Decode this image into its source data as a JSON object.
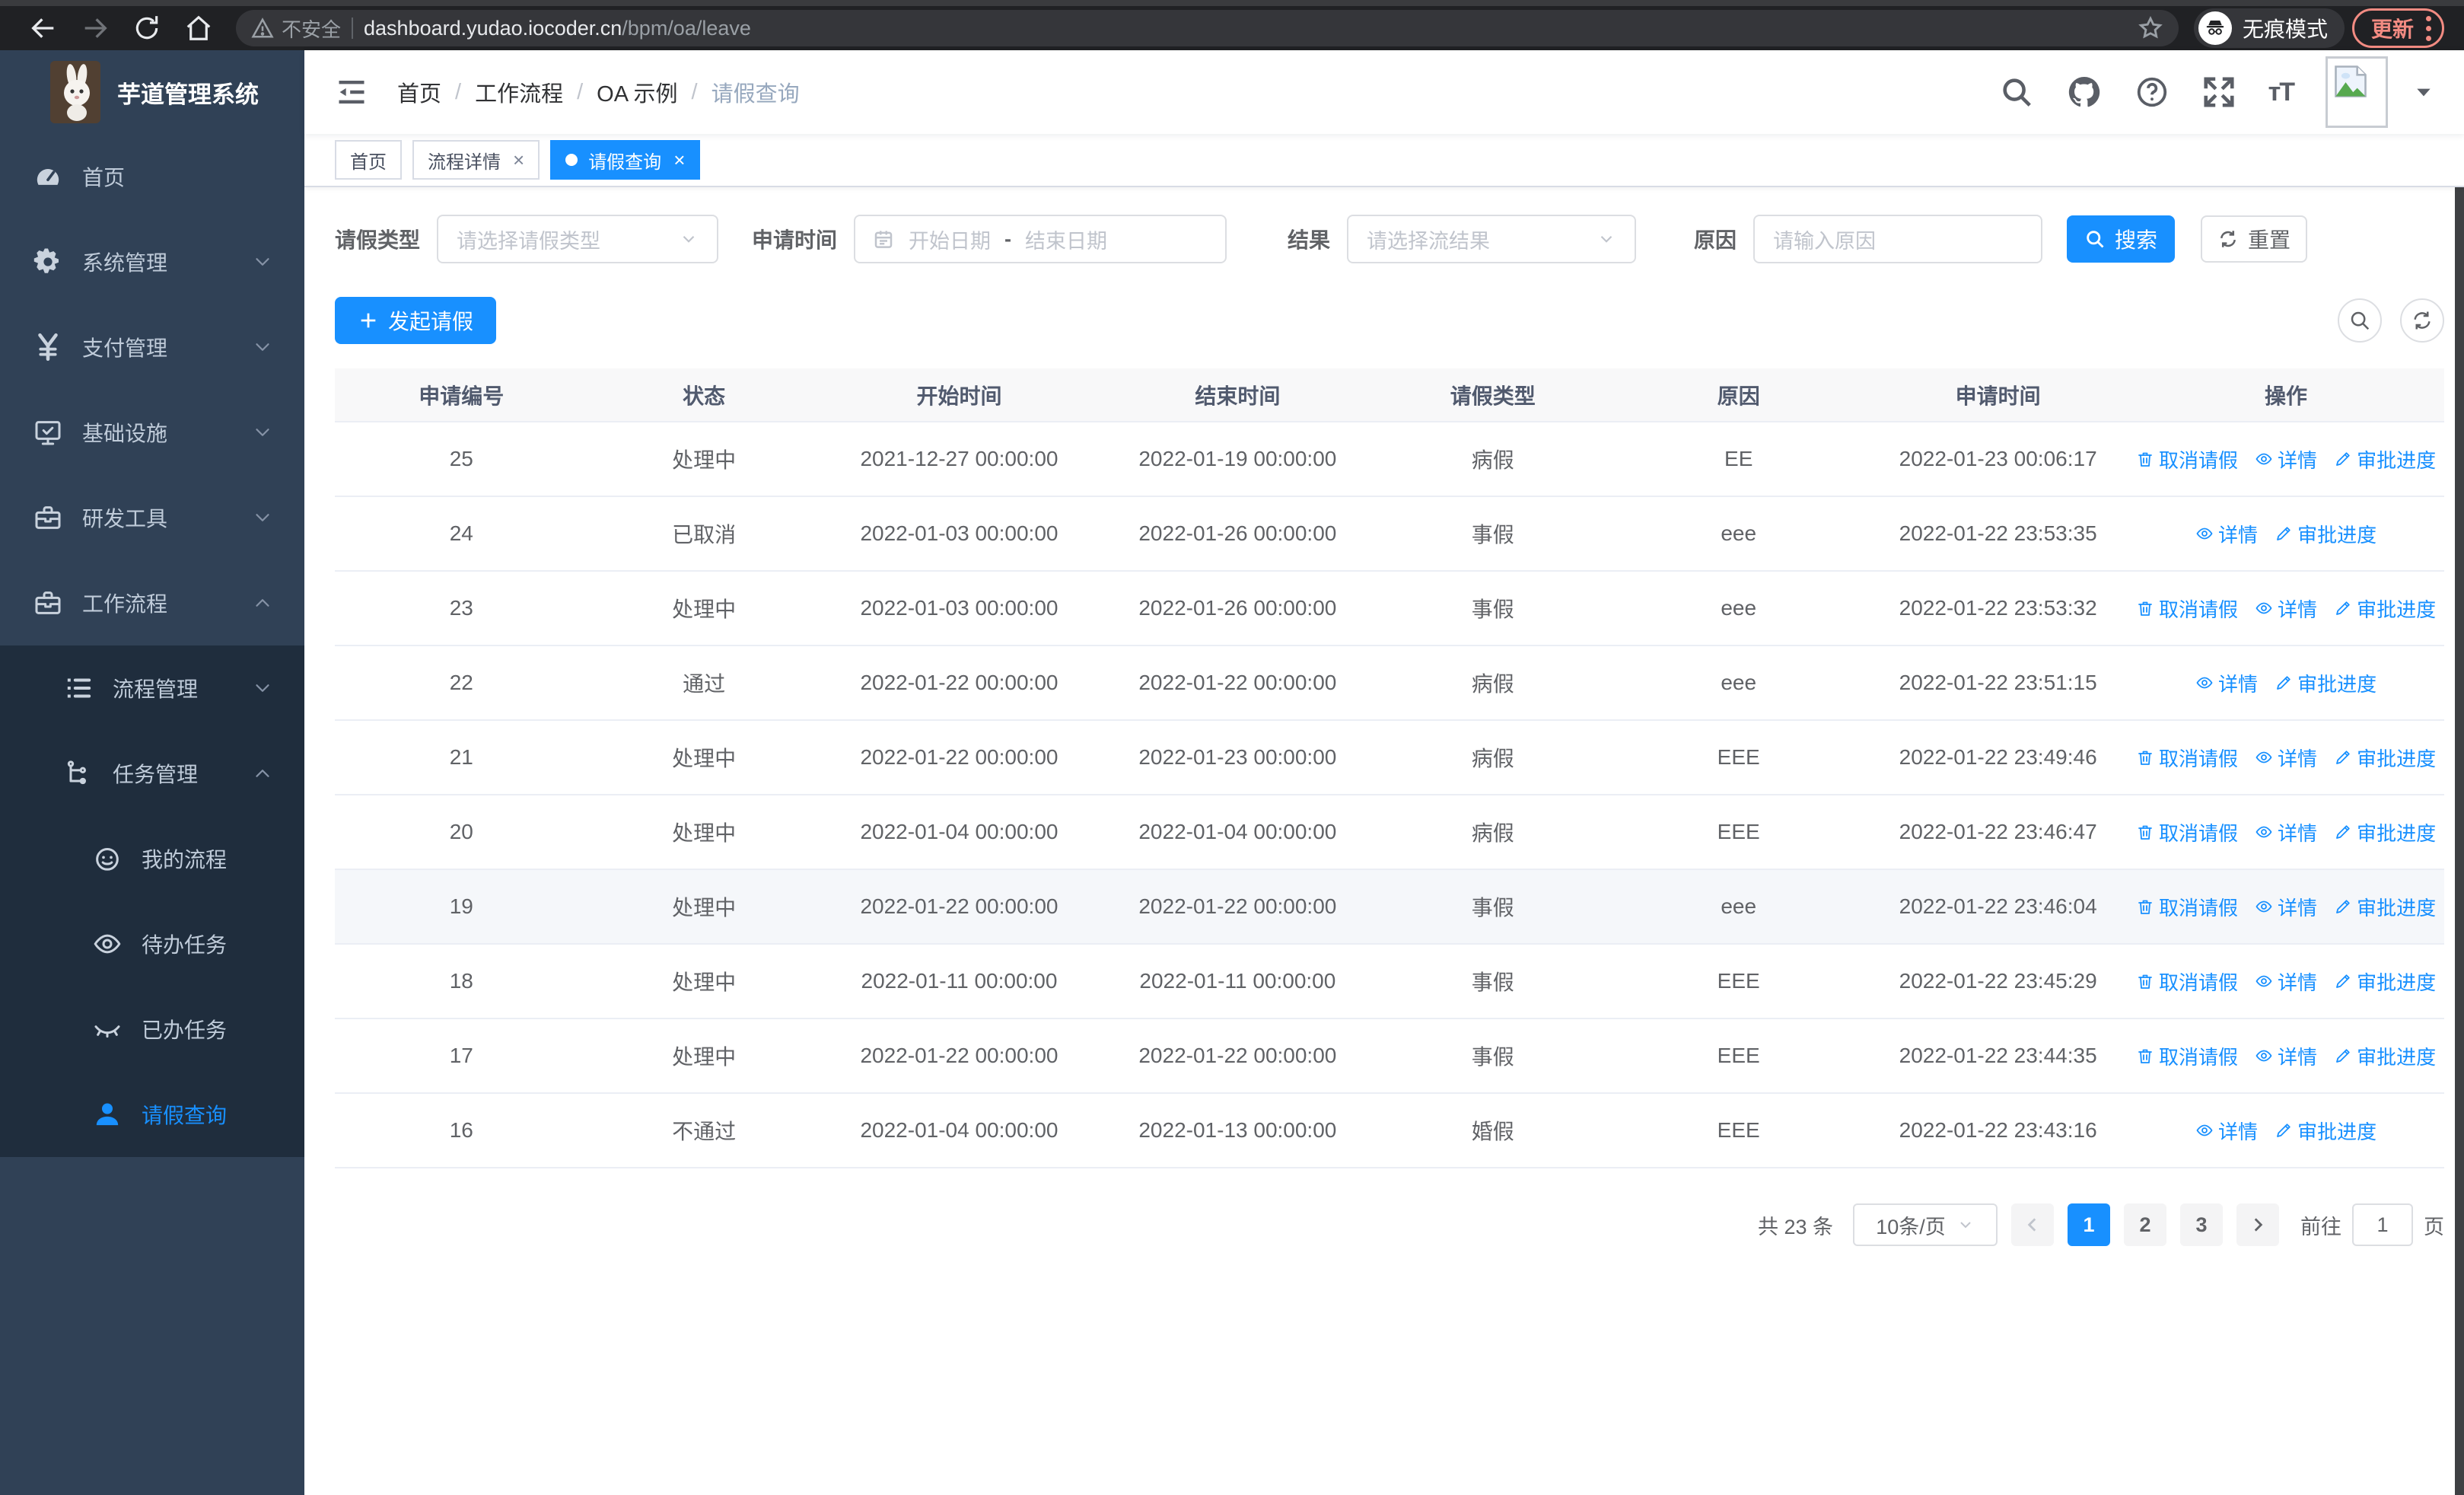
{
  "browser": {
    "security_label": "不安全",
    "url_host": "dashboard.yudao.iocoder.cn",
    "url_path": "/bpm/oa/leave",
    "incognito_label": "无痕模式",
    "update_label": "更新"
  },
  "app": {
    "title": "芋道管理系统"
  },
  "breadcrumb": {
    "items": [
      {
        "label": "首页",
        "current": false
      },
      {
        "label": "工作流程",
        "current": false
      },
      {
        "label": "OA 示例",
        "current": false
      },
      {
        "label": "请假查询",
        "current": true
      }
    ]
  },
  "tabs": [
    {
      "label": "首页",
      "active": false,
      "closable": false
    },
    {
      "label": "流程详情",
      "active": false,
      "closable": true
    },
    {
      "label": "请假查询",
      "active": true,
      "closable": true
    }
  ],
  "sidebar": {
    "items": [
      {
        "label": "首页",
        "icon": "dashboard-icon",
        "level": 1,
        "chevron": "",
        "in_section": false,
        "active": false
      },
      {
        "label": "系统管理",
        "icon": "gear-icon",
        "level": 1,
        "chevron": "down",
        "in_section": false,
        "active": false
      },
      {
        "label": "支付管理",
        "icon": "yen-icon",
        "level": 1,
        "chevron": "down",
        "in_section": false,
        "active": false
      },
      {
        "label": "基础设施",
        "icon": "monitor-icon",
        "level": 1,
        "chevron": "down",
        "in_section": false,
        "active": false
      },
      {
        "label": "研发工具",
        "icon": "toolbox-icon",
        "level": 1,
        "chevron": "down",
        "in_section": false,
        "active": false
      },
      {
        "label": "工作流程",
        "icon": "briefcase-icon",
        "level": 1,
        "chevron": "up",
        "in_section": false,
        "active": false
      },
      {
        "label": "流程管理",
        "icon": "process-icon",
        "level": 2,
        "chevron": "down",
        "in_section": true,
        "active": false
      },
      {
        "label": "任务管理",
        "icon": "tasks-icon",
        "level": 2,
        "chevron": "up",
        "in_section": true,
        "active": false
      },
      {
        "label": "我的流程",
        "icon": "robot-icon",
        "level": 3,
        "chevron": "",
        "in_section": true,
        "active": false
      },
      {
        "label": "待办任务",
        "icon": "eye-open-icon",
        "level": 3,
        "chevron": "",
        "in_section": true,
        "active": false
      },
      {
        "label": "已办任务",
        "icon": "eye-closed-icon",
        "level": 3,
        "chevron": "",
        "in_section": true,
        "active": false
      },
      {
        "label": "请假查询",
        "icon": "user-icon",
        "level": 3,
        "chevron": "",
        "in_section": true,
        "active": true
      }
    ]
  },
  "filters": {
    "type_label": "请假类型",
    "type_placeholder": "请选择请假类型",
    "time_label": "申请时间",
    "date_start_placeholder": "开始日期",
    "date_separator": "-",
    "date_end_placeholder": "结束日期",
    "result_label": "结果",
    "result_placeholder": "请选择流结果",
    "reason_label": "原因",
    "reason_placeholder": "请输入原因",
    "search_label": "搜索",
    "reset_label": "重置"
  },
  "toolbar": {
    "create_label": "发起请假"
  },
  "table": {
    "columns": [
      "申请编号",
      "状态",
      "开始时间",
      "结束时间",
      "请假类型",
      "原因",
      "申请时间",
      "操作"
    ],
    "action_labels": {
      "cancel": "取消请假",
      "detail": "详情",
      "progress": "审批进度"
    },
    "rows": [
      {
        "id": "25",
        "status": "处理中",
        "start": "2021-12-27 00:00:00",
        "end": "2022-01-19 00:00:00",
        "type": "病假",
        "reason": "EE",
        "apply_time": "2022-01-23 00:06:17",
        "actions": [
          "cancel",
          "detail",
          "progress"
        ],
        "highlight": false
      },
      {
        "id": "24",
        "status": "已取消",
        "start": "2022-01-03 00:00:00",
        "end": "2022-01-26 00:00:00",
        "type": "事假",
        "reason": "eee",
        "apply_time": "2022-01-22 23:53:35",
        "actions": [
          "detail",
          "progress"
        ],
        "highlight": false
      },
      {
        "id": "23",
        "status": "处理中",
        "start": "2022-01-03 00:00:00",
        "end": "2022-01-26 00:00:00",
        "type": "事假",
        "reason": "eee",
        "apply_time": "2022-01-22 23:53:32",
        "actions": [
          "cancel",
          "detail",
          "progress"
        ],
        "highlight": false
      },
      {
        "id": "22",
        "status": "通过",
        "start": "2022-01-22 00:00:00",
        "end": "2022-01-22 00:00:00",
        "type": "病假",
        "reason": "eee",
        "apply_time": "2022-01-22 23:51:15",
        "actions": [
          "detail",
          "progress"
        ],
        "highlight": false
      },
      {
        "id": "21",
        "status": "处理中",
        "start": "2022-01-22 00:00:00",
        "end": "2022-01-23 00:00:00",
        "type": "病假",
        "reason": "EEE",
        "apply_time": "2022-01-22 23:49:46",
        "actions": [
          "cancel",
          "detail",
          "progress"
        ],
        "highlight": false
      },
      {
        "id": "20",
        "status": "处理中",
        "start": "2022-01-04 00:00:00",
        "end": "2022-01-04 00:00:00",
        "type": "病假",
        "reason": "EEE",
        "apply_time": "2022-01-22 23:46:47",
        "actions": [
          "cancel",
          "detail",
          "progress"
        ],
        "highlight": false
      },
      {
        "id": "19",
        "status": "处理中",
        "start": "2022-01-22 00:00:00",
        "end": "2022-01-22 00:00:00",
        "type": "事假",
        "reason": "eee",
        "apply_time": "2022-01-22 23:46:04",
        "actions": [
          "cancel",
          "detail",
          "progress"
        ],
        "highlight": true
      },
      {
        "id": "18",
        "status": "处理中",
        "start": "2022-01-11 00:00:00",
        "end": "2022-01-11 00:00:00",
        "type": "事假",
        "reason": "EEE",
        "apply_time": "2022-01-22 23:45:29",
        "actions": [
          "cancel",
          "detail",
          "progress"
        ],
        "highlight": false
      },
      {
        "id": "17",
        "status": "处理中",
        "start": "2022-01-22 00:00:00",
        "end": "2022-01-22 00:00:00",
        "type": "事假",
        "reason": "EEE",
        "apply_time": "2022-01-22 23:44:35",
        "actions": [
          "cancel",
          "detail",
          "progress"
        ],
        "highlight": false
      },
      {
        "id": "16",
        "status": "不通过",
        "start": "2022-01-04 00:00:00",
        "end": "2022-01-13 00:00:00",
        "type": "婚假",
        "reason": "EEE",
        "apply_time": "2022-01-22 23:43:16",
        "actions": [
          "detail",
          "progress"
        ],
        "highlight": false
      }
    ]
  },
  "pagination": {
    "total_label": "共 23 条",
    "page_size_label": "10条/页",
    "pages": [
      "1",
      "2",
      "3"
    ],
    "active_page": "1",
    "goto_label": "前往",
    "goto_value": "1",
    "goto_suffix": "页"
  },
  "colors": {
    "primary": "#1890ff",
    "sidebar_bg": "#304156",
    "submenu_bg": "#1f2d3d",
    "update_red": "#f28b82"
  }
}
